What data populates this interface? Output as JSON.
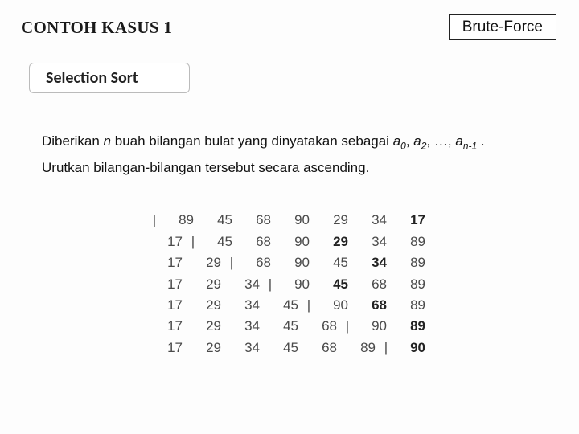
{
  "header": {
    "title_prefix": "CONTOH KASUS ",
    "title_num": "1",
    "badge": "Brute-Force"
  },
  "subtag": "Selection Sort",
  "body": {
    "line1_a": "Diberikan ",
    "line1_n": "n",
    "line1_b": " buah bilangan bulat yang dinyatakan sebagai ",
    "line1_a0": "a",
    "line1_s0": "0",
    "line1_c": ", ",
    "line1_a2": "a",
    "line1_s2": "2",
    "line1_d": ", …, ",
    "line1_an": "a",
    "line1_sn": "n-1",
    "line1_e": " .",
    "line2": "Urutkan bilangan-bilangan tersebut secara ascending."
  },
  "trace": {
    "rows": [
      {
        "bars": [
          0,
          7
        ],
        "bold": [
          7
        ],
        "vals": [
          "89",
          "45",
          "68",
          "90",
          "29",
          "34",
          "17"
        ]
      },
      {
        "bars": [
          1,
          5
        ],
        "bold": [
          5
        ],
        "vals": [
          "17",
          "45",
          "68",
          "90",
          "29",
          "34",
          "89"
        ]
      },
      {
        "bars": [
          2,
          4
        ],
        "bold": [
          5
        ],
        "vals": [
          "17",
          "29",
          "68",
          "90",
          "45",
          "34",
          "89"
        ]
      },
      {
        "bars": [
          3,
          5
        ],
        "bold": [
          5
        ],
        "vals": [
          "17",
          "29",
          "34",
          "90",
          "45",
          "68",
          "89"
        ]
      },
      {
        "bars": [
          4,
          5
        ],
        "bold": [
          6
        ],
        "vals": [
          "17",
          "29",
          "34",
          "45",
          "90",
          "68",
          "89"
        ]
      },
      {
        "bars": [
          5,
          6
        ],
        "bold": [
          7
        ],
        "vals": [
          "17",
          "29",
          "34",
          "45",
          "68",
          "90",
          "89"
        ]
      },
      {
        "bars": [
          6,
          7
        ],
        "bold": [
          7
        ],
        "vals": [
          "17",
          "29",
          "34",
          "45",
          "68",
          "89",
          "90"
        ]
      }
    ]
  }
}
